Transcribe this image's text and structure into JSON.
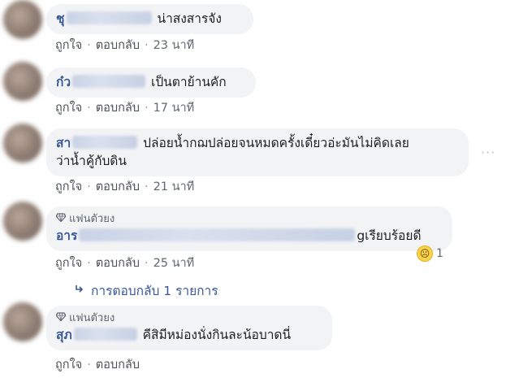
{
  "comments": [
    {
      "name": "ชุ",
      "text": "น่าสงสารจัง",
      "like": "ถูกใจ",
      "reply": "ตอบกลับ",
      "time": "23 นาที"
    },
    {
      "name": "ก๋ว",
      "text": "เป็นตาย้านคัก",
      "like": "ถูกใจ",
      "reply": "ตอบกลับ",
      "time": "17 นาที"
    },
    {
      "name": "สา",
      "text_line1": "ปล่อยน้ำกฌปล่อยจนหมดครั้งเดี๋ยวอ่ะมันไม่คิดเลย",
      "text_line2": "ว่าน้ำคู้กับดิน",
      "like": "ถูกใจ",
      "reply": "ตอบกลับ",
      "time": "21 นาที",
      "more": "···"
    },
    {
      "badge": "แฟนตัวยง",
      "name": "อาร",
      "text": "gเรียบร้อยดี",
      "like": "ถูกใจ",
      "reply": "ตอบกลับ",
      "time": "25 นาที",
      "reaction_emoji": "sad-tear-icon",
      "reaction_count": "1"
    },
    {
      "badge": "แฟนตัวยง",
      "name": "สุภ",
      "text": "คีสิมีหม่องนั่งกินละน้อบาดนี่",
      "like": "ถูกใจ",
      "reply": "ตอบกลับ",
      "time": ""
    }
  ],
  "replies_link": "การตอบกลับ 1 รายการ",
  "colors": {
    "link": "#385898",
    "bubble": "#f2f3f5",
    "meta": "#606770"
  }
}
